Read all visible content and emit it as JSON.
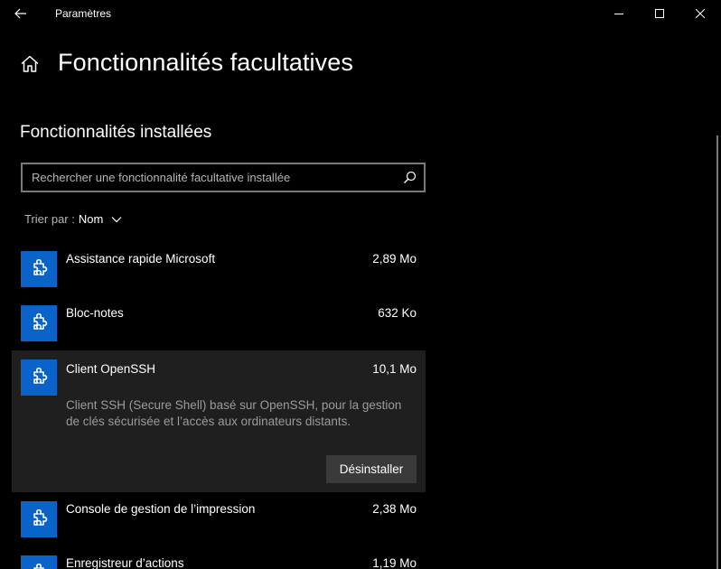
{
  "titlebar": {
    "title": "Paramètres",
    "back_icon": "arrow-left",
    "minimize_icon": "minimize",
    "maximize_icon": "maximize",
    "close_icon": "close"
  },
  "header": {
    "home_icon": "home",
    "title": "Fonctionnalités facultatives"
  },
  "installed": {
    "section_title": "Fonctionnalités installées",
    "search": {
      "placeholder": "Rechercher une fonctionnalité facultative installée",
      "value": "",
      "icon": "search"
    },
    "sort": {
      "label": "Trier par :",
      "value": "Nom",
      "icon": "chevron-down"
    },
    "items": [
      {
        "name": "Assistance rapide Microsoft",
        "size": "2,89 Mo",
        "icon": "puzzle"
      },
      {
        "name": "Bloc-notes",
        "size": "632 Ko",
        "icon": "puzzle"
      },
      {
        "name": "Client OpenSSH",
        "size": "10,1 Mo",
        "icon": "puzzle",
        "description": "Client SSH (Secure Shell) basé sur OpenSSH, pour la gestion de clés sécurisée et l’accès aux ordinateurs distants.",
        "uninstall_label": "Désinstaller"
      },
      {
        "name": "Console de gestion de l’impression",
        "size": "2,38 Mo",
        "icon": "puzzle"
      },
      {
        "name": "Enregistreur d’actions",
        "size": "1,19 Mo",
        "icon": "puzzle"
      }
    ]
  },
  "colors": {
    "background": "#000000",
    "accent": "#0a63c9",
    "expanded_row": "#1f1f1f",
    "button": "#3a3a3a",
    "secondary_text": "#9b9b9b"
  }
}
